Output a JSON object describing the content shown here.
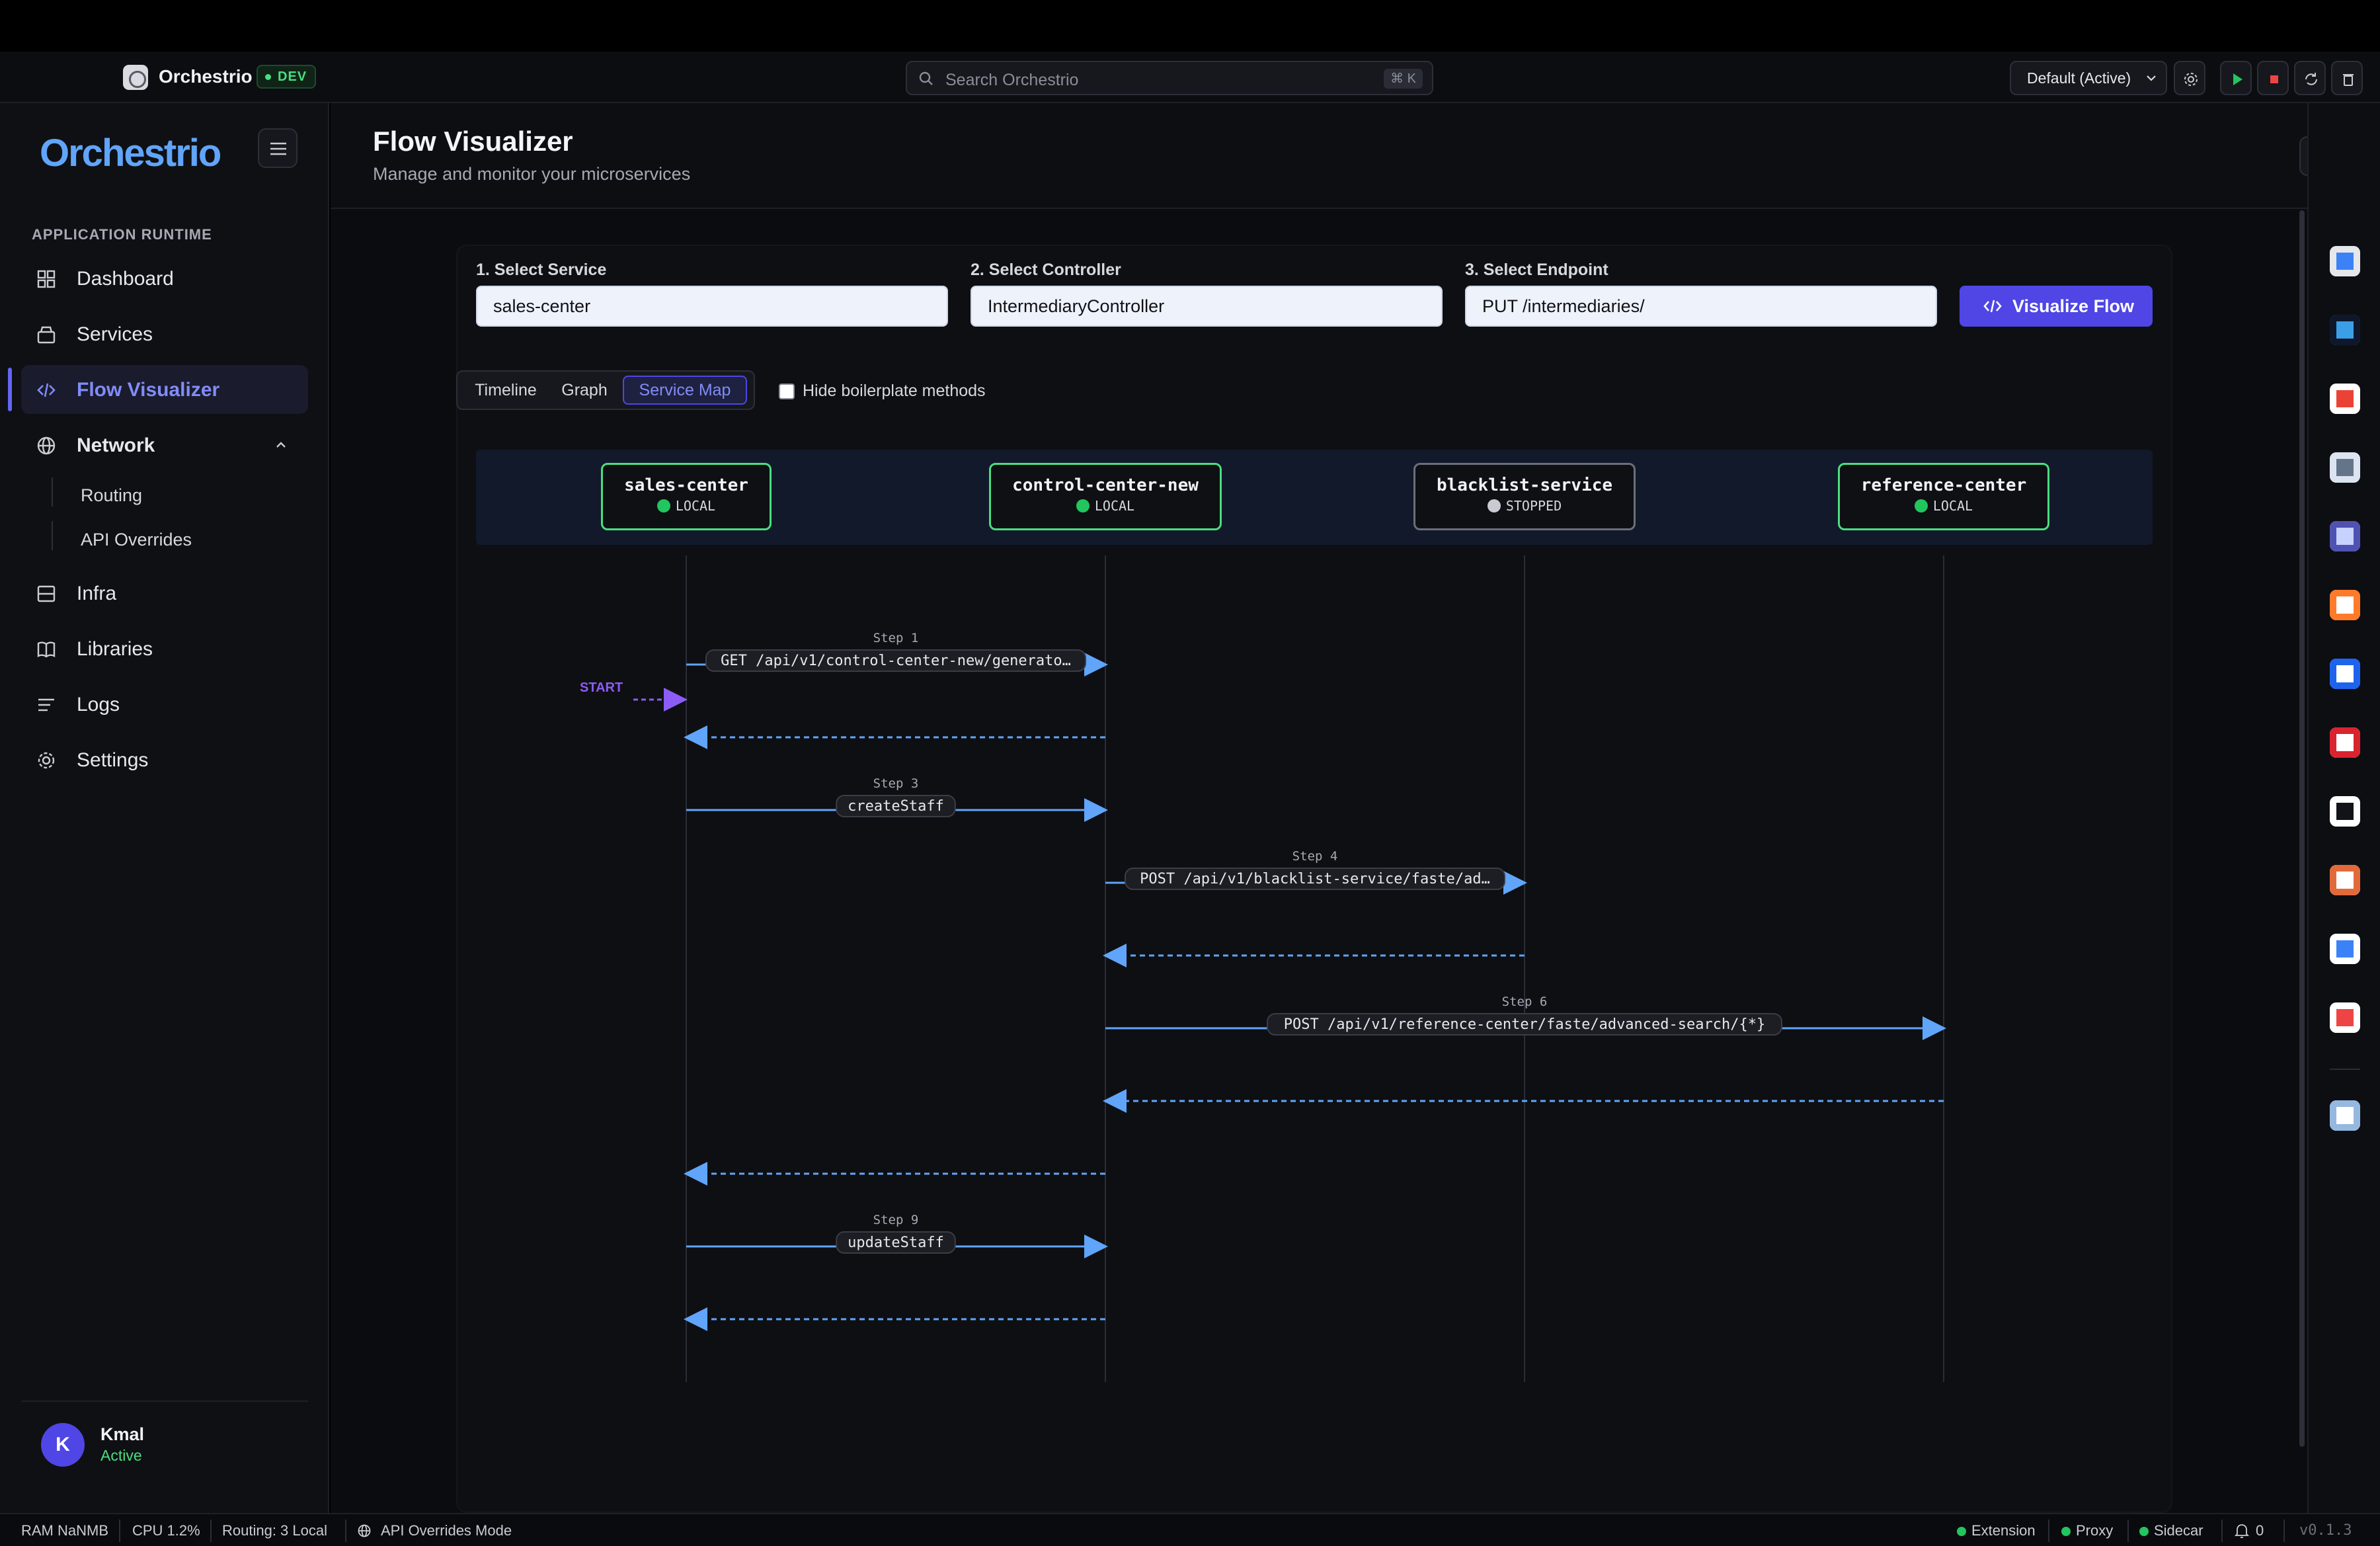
{
  "titlebar": {
    "app_name": "Orchestrio",
    "env_badge": "DEV",
    "search_placeholder": "Search Orchestrio",
    "search_shortcut": "⌘ K",
    "profile_select": "Default (Active)"
  },
  "sidebar": {
    "brand": "Orchestrio",
    "section_label": "APPLICATION RUNTIME",
    "items": [
      {
        "label": "Dashboard",
        "icon": "grid-icon"
      },
      {
        "label": "Services",
        "icon": "box-icon"
      },
      {
        "label": "Flow Visualizer",
        "icon": "code-icon",
        "active": true
      },
      {
        "label": "Network",
        "icon": "globe-icon",
        "expanded": true
      },
      {
        "label": "Infra",
        "icon": "server-icon"
      },
      {
        "label": "Libraries",
        "icon": "book-icon"
      },
      {
        "label": "Logs",
        "icon": "lines-icon"
      },
      {
        "label": "Settings",
        "icon": "gear-icon"
      }
    ],
    "network_children": [
      "Routing",
      "API Overrides"
    ],
    "user": {
      "initial": "K",
      "name": "Kmal",
      "status": "Active"
    }
  },
  "page": {
    "title": "Flow Visualizer",
    "subtitle": "Manage and monitor your microservices"
  },
  "form": {
    "service_label": "1. Select Service",
    "service_value": "sales-center",
    "controller_label": "2. Select Controller",
    "controller_value": "IntermediaryController",
    "endpoint_label": "3. Select Endpoint",
    "endpoint_value": "PUT /intermediaries/",
    "submit_label": "Visualize Flow"
  },
  "view_tabs": {
    "tabs": [
      "Timeline",
      "Graph",
      "Service Map"
    ],
    "active": "Service Map",
    "hide_boilerplate_label": "Hide boilerplate methods",
    "hide_boilerplate_checked": false
  },
  "sequence": {
    "start_label": "START",
    "services": [
      {
        "name": "sales-center",
        "status": "LOCAL"
      },
      {
        "name": "control-center-new",
        "status": "LOCAL"
      },
      {
        "name": "blacklist-service",
        "status": "STOPPED"
      },
      {
        "name": "reference-center",
        "status": "LOCAL"
      }
    ],
    "steps": [
      {
        "step": "Step 1",
        "label": "GET /api/v1/control-center-new/generato…",
        "from": 0,
        "to": 1,
        "kind": "call"
      },
      {
        "step": "",
        "label": "",
        "from": 1,
        "to": 0,
        "kind": "return"
      },
      {
        "step": "Step 3",
        "label": "createStaff",
        "from": 0,
        "to": 1,
        "kind": "call"
      },
      {
        "step": "Step 4",
        "label": "POST /api/v1/blacklist-service/faste/ad…",
        "from": 1,
        "to": 2,
        "kind": "call"
      },
      {
        "step": "",
        "label": "",
        "from": 2,
        "to": 1,
        "kind": "return"
      },
      {
        "step": "Step 6",
        "label": "POST /api/v1/reference-center/faste/advanced-search/{*}",
        "from": 1,
        "to": 3,
        "kind": "call"
      },
      {
        "step": "",
        "label": "",
        "from": 3,
        "to": 1,
        "kind": "return"
      },
      {
        "step": "",
        "label": "",
        "from": 1,
        "to": 0,
        "kind": "return"
      },
      {
        "step": "Step 9",
        "label": "updateStaff",
        "from": 0,
        "to": 1,
        "kind": "call"
      },
      {
        "step": "",
        "label": "",
        "from": 1,
        "to": 0,
        "kind": "return"
      }
    ]
  },
  "dock": {
    "apps": [
      "finder-icon",
      "vscode-icon",
      "chrome-icon",
      "app-icon",
      "teams-icon",
      "sublime-icon",
      "docker-icon",
      "acrobat-icon",
      "clock-icon",
      "claude-icon",
      "vpn-icon",
      "calendar-icon",
      "globe-icon"
    ]
  },
  "statusbar": {
    "ram": "RAM NaNMB",
    "cpu": "CPU 1.2%",
    "routing": "Routing: 3 Local",
    "overrides": "API Overrides Mode",
    "extension": "Extension",
    "proxy": "Proxy",
    "sidecar": "Sidecar",
    "notifications": "0",
    "version": "v0.1.3"
  },
  "colors": {
    "accent": "#4f46e5",
    "accent_text": "#818cf8",
    "local": "#22c55e",
    "arrow": "#60a5fa",
    "start": "#8b5cf6"
  }
}
